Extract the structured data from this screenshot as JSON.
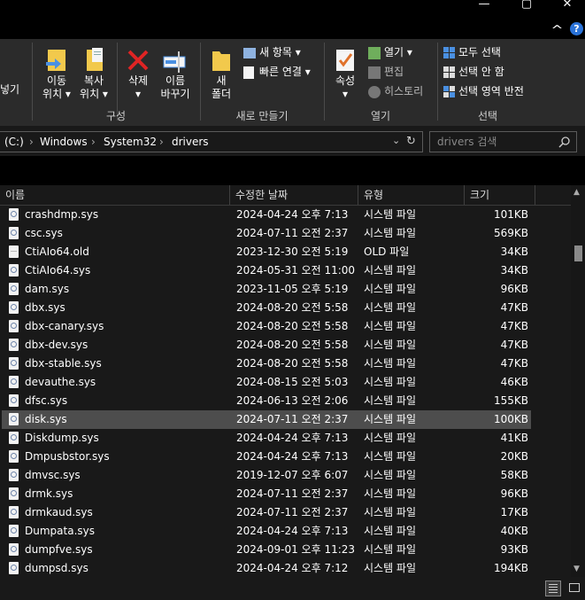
{
  "window": {
    "minimize_glyph": "—",
    "maximize_glyph": "▢",
    "close_glyph": "✕",
    "expand_ribbon_glyph": "^",
    "help_glyph": "?"
  },
  "ribbon": {
    "organize": {
      "paste_partial": "넣기",
      "move_to": "이동\n위치 ▾",
      "copy_to": "복사\n위치 ▾",
      "delete": "삭제\n▾",
      "rename": "이름\n바꾸기",
      "group_label": "구성"
    },
    "new": {
      "new_folder": "새\n폴더",
      "new_item": "새 항목 ▾",
      "easy_access": "빠른 연결 ▾",
      "group_label": "새로 만들기"
    },
    "open": {
      "properties": "속성\n▾",
      "open": "열기 ▾",
      "edit": "편집",
      "history": "히스토리",
      "group_label": "열기"
    },
    "select": {
      "select_all": "모두 선택",
      "select_none": "선택 안 함",
      "invert_selection": "선택 영역 반전",
      "group_label": "선택"
    }
  },
  "address": {
    "crumbs": [
      "(C:)",
      "Windows",
      "System32",
      "drivers"
    ],
    "separator": "›",
    "search_placeholder": "drivers 검색"
  },
  "columns": {
    "name": "이름",
    "modified": "수정한 날짜",
    "type": "유형",
    "size": "크기"
  },
  "files": [
    {
      "name": "crashdmp.sys",
      "modified": "2024-04-24 오후 7:13",
      "type": "시스템 파일",
      "size": "101KB",
      "icon": "system-file-icon"
    },
    {
      "name": "csc.sys",
      "modified": "2024-07-11 오전 2:37",
      "type": "시스템 파일",
      "size": "569KB",
      "icon": "system-file-icon"
    },
    {
      "name": "CtiAIo64.old",
      "modified": "2023-12-30 오전 5:19",
      "type": "OLD 파일",
      "size": "34KB",
      "icon": "blank-file-icon"
    },
    {
      "name": "CtiAIo64.sys",
      "modified": "2024-05-31 오전 11:00",
      "type": "시스템 파일",
      "size": "34KB",
      "icon": "system-file-icon"
    },
    {
      "name": "dam.sys",
      "modified": "2023-11-05 오후 5:19",
      "type": "시스템 파일",
      "size": "96KB",
      "icon": "system-file-icon"
    },
    {
      "name": "dbx.sys",
      "modified": "2024-08-20 오전 5:58",
      "type": "시스템 파일",
      "size": "47KB",
      "icon": "system-file-icon"
    },
    {
      "name": "dbx-canary.sys",
      "modified": "2024-08-20 오전 5:58",
      "type": "시스템 파일",
      "size": "47KB",
      "icon": "system-file-icon"
    },
    {
      "name": "dbx-dev.sys",
      "modified": "2024-08-20 오전 5:58",
      "type": "시스템 파일",
      "size": "47KB",
      "icon": "system-file-icon"
    },
    {
      "name": "dbx-stable.sys",
      "modified": "2024-08-20 오전 5:58",
      "type": "시스템 파일",
      "size": "47KB",
      "icon": "system-file-icon"
    },
    {
      "name": "devauthe.sys",
      "modified": "2024-08-15 오전 5:03",
      "type": "시스템 파일",
      "size": "46KB",
      "icon": "system-file-icon"
    },
    {
      "name": "dfsc.sys",
      "modified": "2024-06-13 오전 2:06",
      "type": "시스템 파일",
      "size": "155KB",
      "icon": "system-file-icon"
    },
    {
      "name": "disk.sys",
      "modified": "2024-07-11 오전 2:37",
      "type": "시스템 파일",
      "size": "100KB",
      "icon": "system-file-icon",
      "selected": true
    },
    {
      "name": "Diskdump.sys",
      "modified": "2024-04-24 오후 7:13",
      "type": "시스템 파일",
      "size": "41KB",
      "icon": "system-file-icon"
    },
    {
      "name": "Dmpusbstor.sys",
      "modified": "2024-04-24 오후 7:13",
      "type": "시스템 파일",
      "size": "20KB",
      "icon": "system-file-icon"
    },
    {
      "name": "dmvsc.sys",
      "modified": "2019-12-07 오후 6:07",
      "type": "시스템 파일",
      "size": "58KB",
      "icon": "system-file-icon"
    },
    {
      "name": "drmk.sys",
      "modified": "2024-07-11 오전 2:37",
      "type": "시스템 파일",
      "size": "96KB",
      "icon": "system-file-icon"
    },
    {
      "name": "drmkaud.sys",
      "modified": "2024-07-11 오전 2:37",
      "type": "시스템 파일",
      "size": "17KB",
      "icon": "system-file-icon"
    },
    {
      "name": "Dumpata.sys",
      "modified": "2024-04-24 오후 7:13",
      "type": "시스템 파일",
      "size": "40KB",
      "icon": "system-file-icon"
    },
    {
      "name": "dumpfve.sys",
      "modified": "2024-09-01 오후 11:23",
      "type": "시스템 파일",
      "size": "93KB",
      "icon": "system-file-icon"
    },
    {
      "name": "dumpsd.sys",
      "modified": "2024-04-24 오후 7:12",
      "type": "시스템 파일",
      "size": "194KB",
      "icon": "system-file-icon"
    }
  ]
}
